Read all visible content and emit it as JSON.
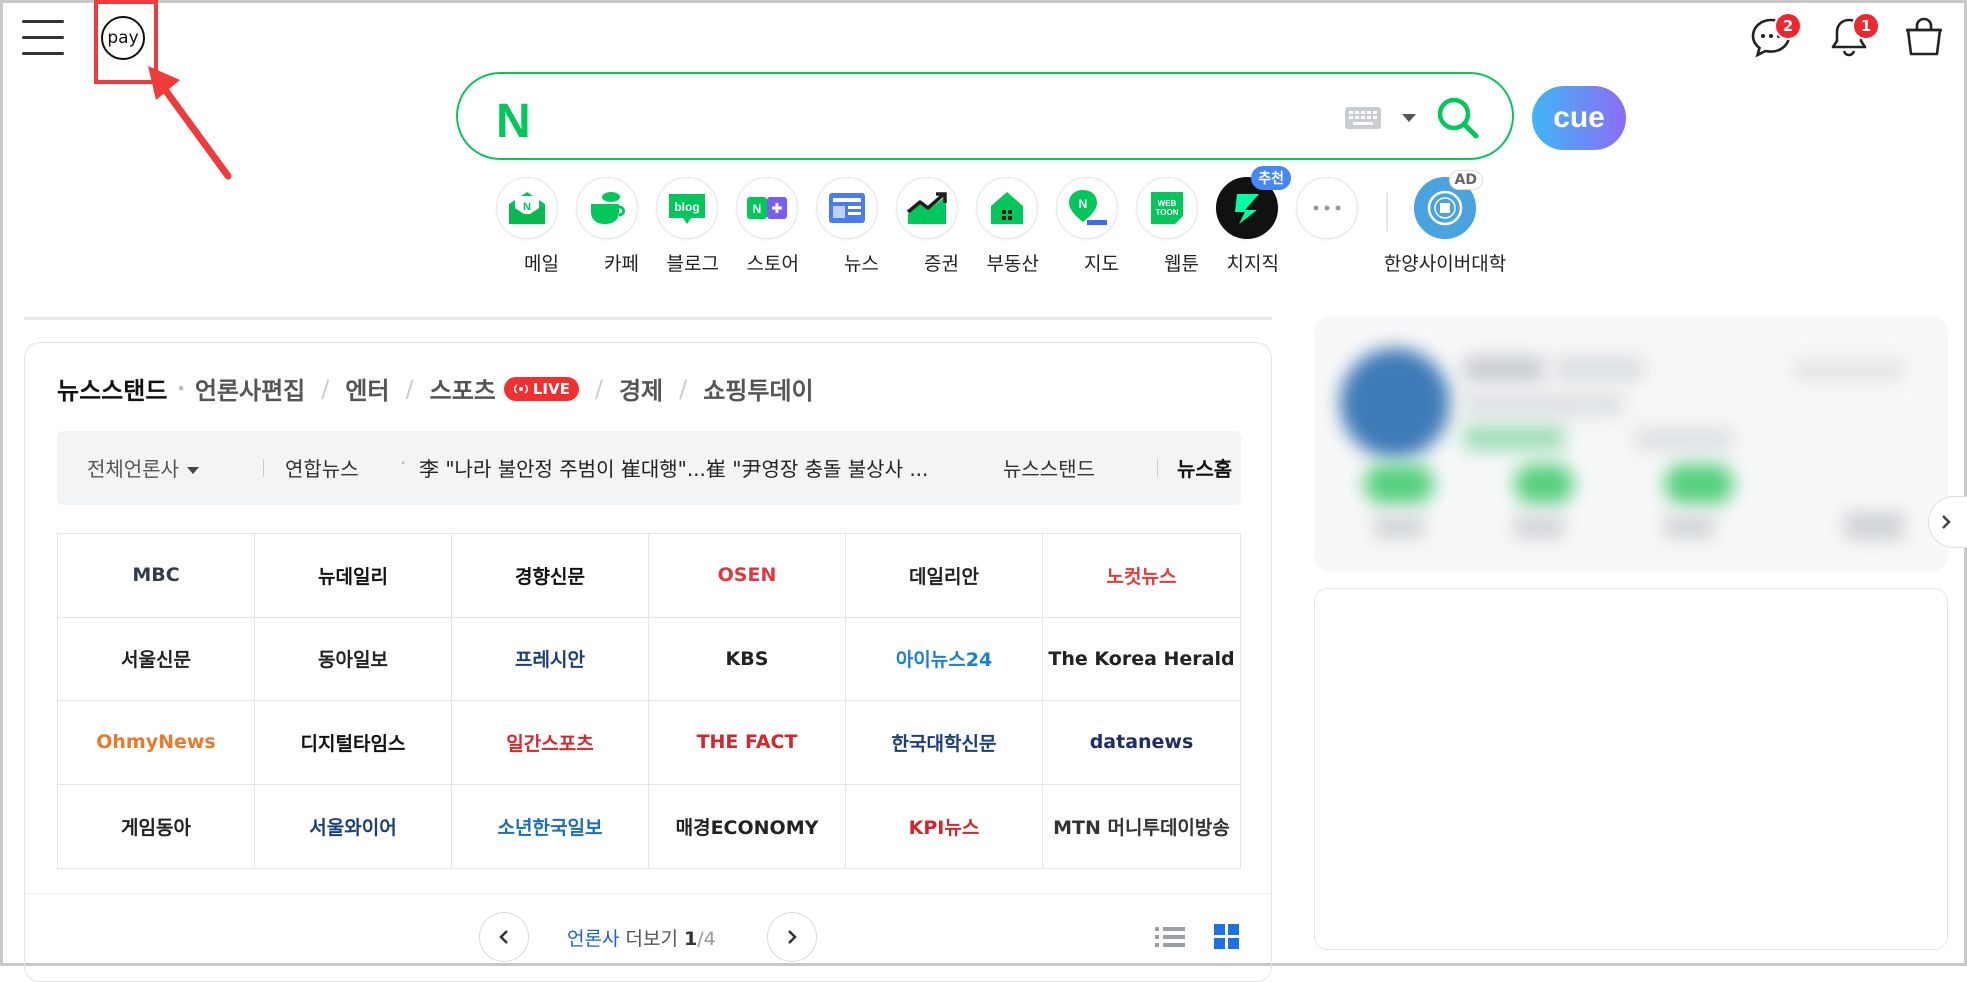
{
  "header": {
    "pay_label": "pay",
    "badges": {
      "talk": "2",
      "alerts": "1"
    }
  },
  "search": {
    "logo": "N",
    "placeholder": "",
    "cue_label": "cue"
  },
  "shortcuts": [
    {
      "label": "메일",
      "icon": "mail-icon"
    },
    {
      "label": "카페",
      "icon": "cafe-icon"
    },
    {
      "label": "블로그",
      "icon": "blog-icon",
      "glyph": "blog"
    },
    {
      "label": "스토어",
      "icon": "store-icon"
    },
    {
      "label": "뉴스",
      "icon": "news-icon"
    },
    {
      "label": "증권",
      "icon": "stock-icon"
    },
    {
      "label": "부동산",
      "icon": "realestate-icon"
    },
    {
      "label": "지도",
      "icon": "map-icon",
      "glyph": "N"
    },
    {
      "label": "웹툰",
      "icon": "webtoon-icon",
      "glyph": "WEBTOON"
    },
    {
      "label": "치지직",
      "icon": "chzzk-icon",
      "tag": "추천"
    },
    {
      "label": "",
      "icon": "more-icon"
    },
    {
      "label": "한양사이버대학",
      "icon": "hanyang-cyber-univ-icon",
      "tag": "AD"
    }
  ],
  "news": {
    "tabs": {
      "main": "뉴스스탠드",
      "items": [
        "언론사편집",
        "엔터",
        "스포츠",
        "경제",
        "쇼핑투데이"
      ],
      "live": "LIVE"
    },
    "ticker": {
      "all_press": "전체언론사",
      "press": "연합뉴스",
      "headline": "李 \"나라 불안정 주범이 崔대행\"...崔 \"尹영장 충돌 불상사 ...",
      "link_newsstand": "뉴스스탠드",
      "link_newshome": "뉴스홈"
    },
    "press": [
      {
        "name": "MBC",
        "color": "#333b4d"
      },
      {
        "name": "뉴데일리",
        "color": "#111111"
      },
      {
        "name": "경향신문",
        "color": "#111111"
      },
      {
        "name": "OSEN",
        "color": "#e0383d"
      },
      {
        "name": "데일리안",
        "color": "#222222"
      },
      {
        "name": "노컷뉴스",
        "color": "#e33a3a"
      },
      {
        "name": "서울신문",
        "color": "#222222"
      },
      {
        "name": "동아일보",
        "color": "#222222"
      },
      {
        "name": "프레시안",
        "color": "#1b3f7a"
      },
      {
        "name": "KBS",
        "color": "#222222"
      },
      {
        "name": "아이뉴스24",
        "color": "#1a7fd6"
      },
      {
        "name": "The Korea Herald",
        "color": "#222222"
      },
      {
        "name": "OhmyNews",
        "color": "#e97a2b"
      },
      {
        "name": "디지털타임스",
        "color": "#111111"
      },
      {
        "name": "일간스포츠",
        "color": "#d6262c"
      },
      {
        "name": "THE FACT",
        "color": "#d6262c"
      },
      {
        "name": "한국대학신문",
        "color": "#1b3f7a"
      },
      {
        "name": "datanews",
        "color": "#1b2d6b"
      },
      {
        "name": "게임동아",
        "color": "#222222"
      },
      {
        "name": "서울와이어",
        "color": "#1b3f7a"
      },
      {
        "name": "소년한국일보",
        "color": "#1b6fb6"
      },
      {
        "name": "매경ECONOMY",
        "color": "#222222"
      },
      {
        "name": "KPI뉴스",
        "color": "#d6262c"
      },
      {
        "name": "MTN 머니투데이방송",
        "color": "#333333"
      }
    ],
    "pagination": {
      "label_a": "언론사",
      "label_b": "더보기",
      "current": "1",
      "total": "/4"
    }
  }
}
